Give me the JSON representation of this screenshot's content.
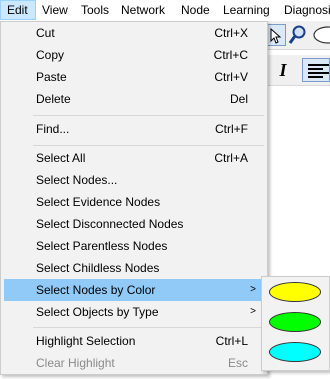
{
  "menubar": {
    "items": [
      {
        "label": "Edit",
        "active": true
      },
      {
        "label": "View"
      },
      {
        "label": "Tools"
      },
      {
        "label": "Network"
      },
      {
        "label": "Node"
      },
      {
        "label": "Learning"
      },
      {
        "label": "Diagnosi"
      }
    ]
  },
  "toolbar": {
    "italic_label": "I",
    "icons": [
      "zoom-icon",
      "oval-tool-icon",
      "arrow-tool-icon",
      "align-left-icon"
    ]
  },
  "edit_menu": {
    "items": [
      {
        "label": "Cut",
        "shortcut": "Ctrl+X"
      },
      {
        "label": "Copy",
        "shortcut": "Ctrl+C"
      },
      {
        "label": "Paste",
        "shortcut": "Ctrl+V"
      },
      {
        "label": "Delete",
        "shortcut": "Del"
      },
      {
        "label": "Find...",
        "shortcut": "Ctrl+F"
      },
      {
        "label": "Select All",
        "shortcut": "Ctrl+A"
      },
      {
        "label": "Select Nodes...",
        "shortcut": ""
      },
      {
        "label": "Select Evidence Nodes",
        "shortcut": ""
      },
      {
        "label": "Select Disconnected Nodes",
        "shortcut": ""
      },
      {
        "label": "Select Parentless Nodes",
        "shortcut": ""
      },
      {
        "label": "Select Childless Nodes",
        "shortcut": ""
      },
      {
        "label": "Select Nodes by Color",
        "shortcut": "",
        "submenu": true,
        "highlighted": true
      },
      {
        "label": "Select Objects by Type",
        "shortcut": "",
        "submenu": true
      },
      {
        "label": "Highlight Selection",
        "shortcut": "Ctrl+L"
      },
      {
        "label": "Clear Highlight",
        "shortcut": "Esc",
        "disabled": true
      }
    ],
    "submenu_arrow": ">"
  },
  "color_submenu": {
    "swatches": [
      {
        "name": "yellow",
        "color": "#ffff00"
      },
      {
        "name": "green",
        "color": "#00ff00"
      },
      {
        "name": "cyan",
        "color": "#00ffff"
      }
    ]
  },
  "colors": {
    "highlight": "#91c9f7",
    "menu_bg": "#f2f2f2",
    "menubar_active": "#cce8ff"
  }
}
